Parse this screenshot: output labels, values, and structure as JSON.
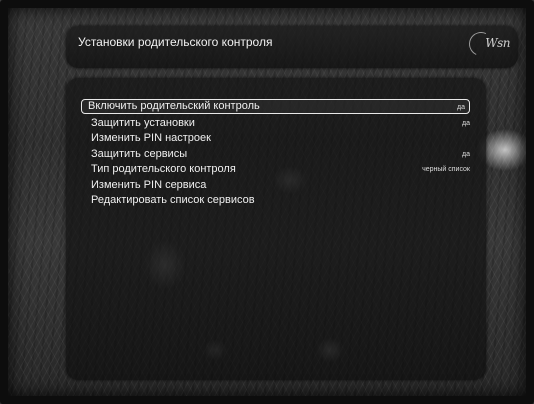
{
  "header": {
    "title": "Установки родительского контроля",
    "brand": "Wsn"
  },
  "menu": {
    "items": [
      {
        "label": "Включить родительский контроль",
        "value": "да",
        "selected": true
      },
      {
        "label": "Защитить установки",
        "value": "да",
        "selected": false
      },
      {
        "label": "Изменить  PIN настроек",
        "value": "",
        "selected": false
      },
      {
        "label": "Защитить сервисы",
        "value": "да",
        "selected": false
      },
      {
        "label": "Тип родительского контроля",
        "value": "черный список",
        "selected": false
      },
      {
        "label": "Изменить PIN сервиса",
        "value": "",
        "selected": false
      },
      {
        "label": "Редактировать список сервисов",
        "value": "",
        "selected": false
      }
    ]
  }
}
